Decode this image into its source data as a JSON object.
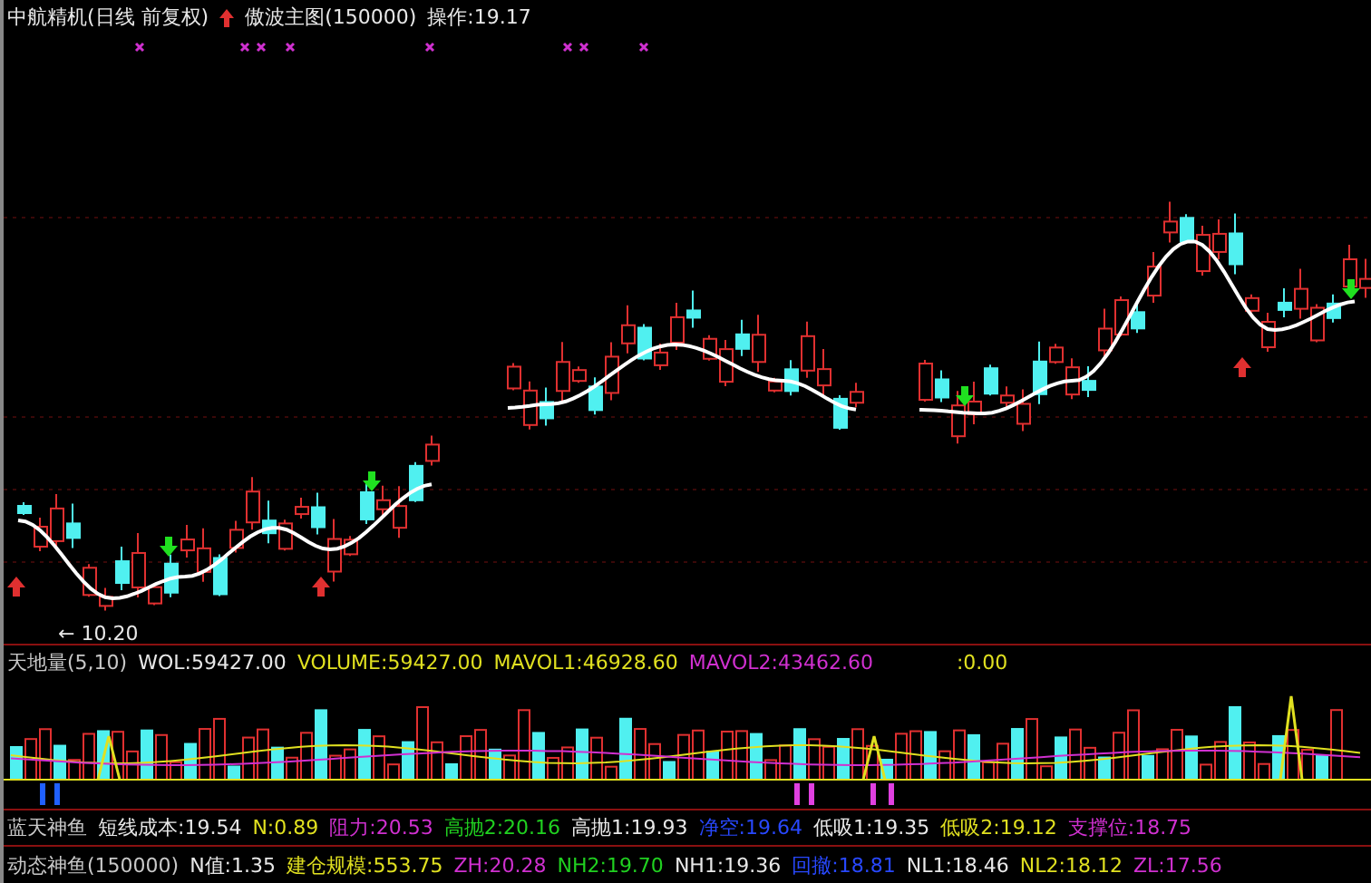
{
  "header": {
    "title": "中航精机(日线 前复权)",
    "indicator": "傲波主图(150000)",
    "reading": "操作:19.17"
  },
  "price_label": "← 10.20",
  "volume": {
    "segments": [
      {
        "text": "天地量(5,10)",
        "color": "#c8c8c8"
      },
      {
        "text": "WOL:59427.00",
        "color": "#e8e8e8"
      },
      {
        "text": "VOLUME:59427.00",
        "color": "#e0e020"
      },
      {
        "text": "MAVOL1:46928.60",
        "color": "#e0e020"
      },
      {
        "text": "MAVOL2:43462.60",
        "color": "#d030d0"
      },
      {
        "text": ":0.00",
        "color": "#e0e020"
      }
    ]
  },
  "rows": [
    {
      "segments": [
        {
          "text": "蓝天神鱼",
          "color": "#c8c8c8"
        },
        {
          "text": "短线成本:19.54",
          "color": "#e8e8e8"
        },
        {
          "text": "N:0.89",
          "color": "#e0e020"
        },
        {
          "text": "阻力:20.53",
          "color": "#d030d0"
        },
        {
          "text": "高抛2:20.16",
          "color": "#20d020"
        },
        {
          "text": "高抛1:19.93",
          "color": "#e8e8e8"
        },
        {
          "text": "净空:19.64",
          "color": "#2848ff"
        },
        {
          "text": "低吸1:19.35",
          "color": "#e8e8e8"
        },
        {
          "text": "低吸2:19.12",
          "color": "#e0e020"
        },
        {
          "text": "支撑位:18.75",
          "color": "#d030d0"
        }
      ]
    },
    {
      "segments": [
        {
          "text": "动态神鱼(150000)",
          "color": "#c8c8c8"
        },
        {
          "text": "N值:1.35",
          "color": "#e8e8e8"
        },
        {
          "text": "建仓规模:553.75",
          "color": "#e0e020"
        },
        {
          "text": "ZH:20.28",
          "color": "#d030d0"
        },
        {
          "text": "NH2:19.70",
          "color": "#20d020"
        },
        {
          "text": "NH1:19.36",
          "color": "#e8e8e8"
        },
        {
          "text": "回撤:18.81",
          "color": "#2848ff"
        },
        {
          "text": "NL1:18.46",
          "color": "#e8e8e8"
        },
        {
          "text": "NL2:18.12",
          "color": "#e0e020"
        },
        {
          "text": "ZL:17.56",
          "color": "#d030d0"
        }
      ]
    }
  ]
}
